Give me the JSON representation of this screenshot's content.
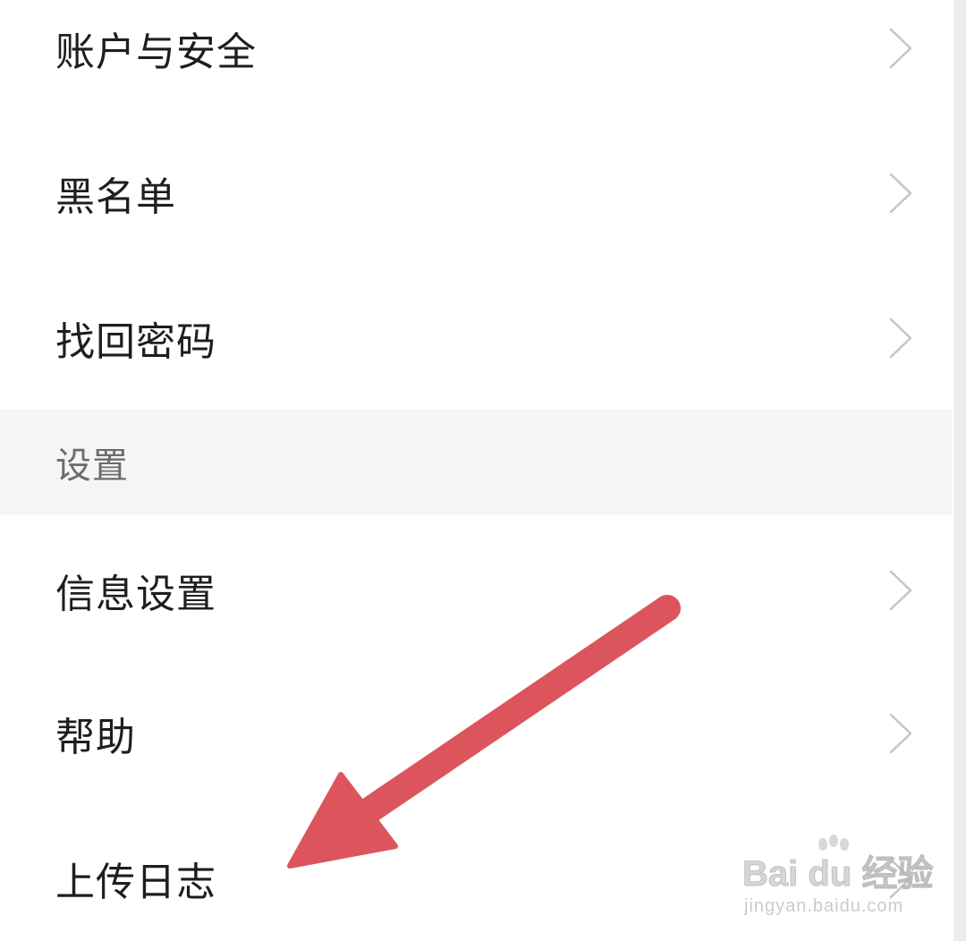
{
  "settings_list": {
    "items_top": [
      {
        "label": "账户与安全"
      },
      {
        "label": "黑名单"
      },
      {
        "label": "找回密码"
      }
    ],
    "section_header": "设置",
    "items_bottom": [
      {
        "label": "信息设置"
      },
      {
        "label": "帮助"
      },
      {
        "label": "上传日志"
      }
    ]
  },
  "icons": {
    "chevron": "chevron-right-icon",
    "annotation": "pointer-arrow-icon"
  },
  "colors": {
    "background": "#ffffff",
    "section_background": "#f5f5f5",
    "label_text": "#1e1e1e",
    "section_text": "#6b6b6b",
    "chevron": "#c4c4c4",
    "annotation_arrow": "#dc555c"
  },
  "watermark": {
    "brand": "Bai du 经验",
    "url": "jingyan.baidu.com"
  }
}
